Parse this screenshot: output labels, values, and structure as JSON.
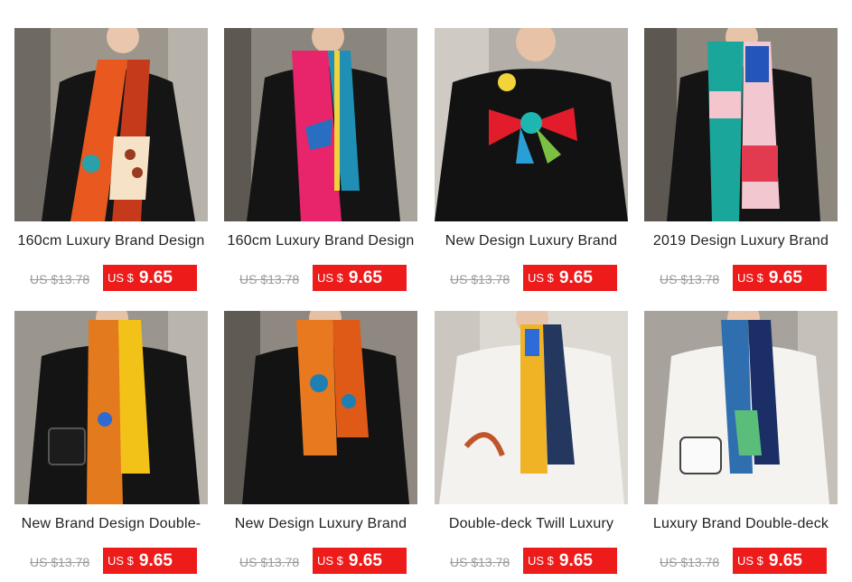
{
  "products": [
    {
      "title": "160cm Luxury Brand Design",
      "old_price": "US $13.78",
      "currency": "US $",
      "price": "9.65",
      "image": "model-black-top-orange-scarf"
    },
    {
      "title": "160cm Luxury Brand Design",
      "old_price": "US $13.78",
      "currency": "US $",
      "price": "9.65",
      "image": "model-black-top-pink-horse-scarf"
    },
    {
      "title": "New Design Luxury Brand",
      "old_price": "US $13.78",
      "currency": "US $",
      "price": "9.65",
      "image": "model-black-top-red-bow-scarf"
    },
    {
      "title": "2019 Design Luxury Brand",
      "old_price": "US $13.78",
      "currency": "US $",
      "price": "9.65",
      "image": "model-black-top-teal-pink-scarf"
    },
    {
      "title": "New Brand Design Double-",
      "old_price": "US $13.78",
      "currency": "US $",
      "price": "9.65",
      "image": "model-black-top-orange-yellow-scarf"
    },
    {
      "title": "New Design Luxury Brand",
      "old_price": "US $13.78",
      "currency": "US $",
      "price": "9.65",
      "image": "model-black-top-orange-elephant-scarf"
    },
    {
      "title": "Double-deck Twill Luxury",
      "old_price": "US $13.78",
      "currency": "US $",
      "price": "9.65",
      "image": "model-white-top-yellow-navy-scarf"
    },
    {
      "title": "Luxury Brand Double-deck",
      "old_price": "US $13.78",
      "currency": "US $",
      "price": "9.65",
      "image": "model-white-top-blue-green-scarf"
    }
  ],
  "colors": {
    "price_tag": "#ee1b1b",
    "old_price": "#9a9a9a",
    "title": "#222222"
  }
}
